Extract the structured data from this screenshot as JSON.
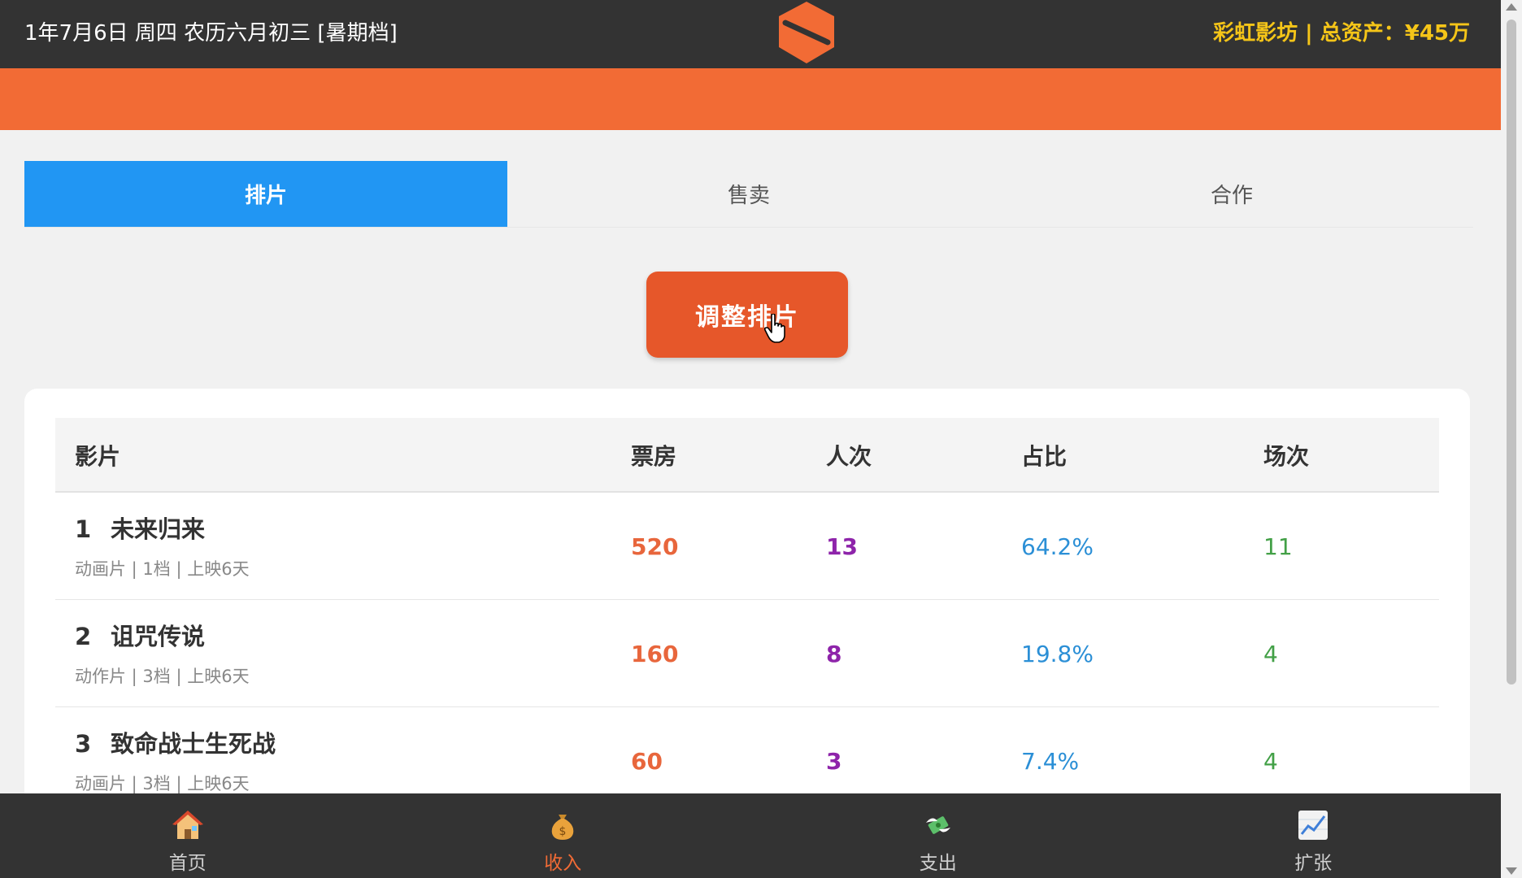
{
  "header": {
    "date_text": "1年7月6日 周四 农历六月初三 [暑期档]",
    "assets_text": "彩虹影坊 | 总资产：¥45万",
    "logo_icon": "hexagon-logo-icon"
  },
  "tabs": [
    {
      "label": "排片",
      "active": true
    },
    {
      "label": "售卖",
      "active": false
    },
    {
      "label": "合作",
      "active": false
    }
  ],
  "adjust_button": {
    "label": "调整排片"
  },
  "table": {
    "columns": [
      "影片",
      "票房",
      "人次",
      "占比",
      "场次"
    ],
    "rows": [
      {
        "index": "1",
        "title": "未来归来",
        "meta": "动画片 | 1档 | 上映6天",
        "box_office": "520",
        "people": "13",
        "share": "64.2%",
        "shows": "11"
      },
      {
        "index": "2",
        "title": "诅咒传说",
        "meta": "动作片 | 3档 | 上映6天",
        "box_office": "160",
        "people": "8",
        "share": "19.8%",
        "shows": "4"
      },
      {
        "index": "3",
        "title": "致命战士生死战",
        "meta": "动画片 | 3档 | 上映6天",
        "box_office": "60",
        "people": "3",
        "share": "7.4%",
        "shows": "4"
      }
    ]
  },
  "bottom_nav": [
    {
      "label": "首页",
      "icon": "house-icon",
      "active": false
    },
    {
      "label": "收入",
      "icon": "money-bag-icon",
      "active": true
    },
    {
      "label": "支出",
      "icon": "money-wings-icon",
      "active": false
    },
    {
      "label": "扩张",
      "icon": "chart-up-icon",
      "active": false
    }
  ],
  "colors": {
    "topbar": "#333333",
    "accent_orange": "#f26b35",
    "tab_active": "#2196f3",
    "box_office": "#e8663c",
    "people": "#8e24aa",
    "share": "#2b8fd6",
    "shows": "#43a047",
    "assets_text": "#f5c518"
  }
}
